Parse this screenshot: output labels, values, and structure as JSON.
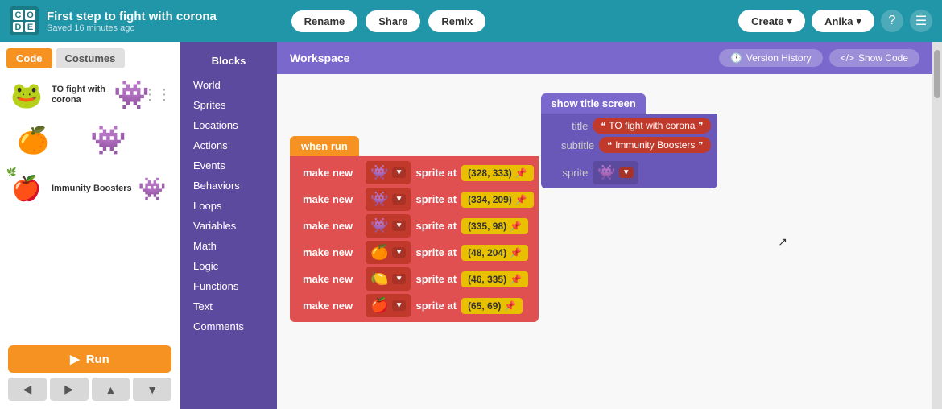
{
  "topbar": {
    "logo": [
      "C",
      "O",
      "D",
      "E"
    ],
    "project_title": "First step to fight with corona",
    "saved_status": "Saved 16 minutes ago",
    "rename_label": "Rename",
    "share_label": "Share",
    "remix_label": "Remix",
    "create_label": "Create",
    "user_label": "Anika",
    "help_icon": "?",
    "menu_icon": "☰"
  },
  "left_panel": {
    "tab_code": "Code",
    "tab_costumes": "Costumes",
    "sprites": [
      {
        "label": "TO fight with corona",
        "emoji": "🐸",
        "monster": "👾"
      },
      {
        "label": "",
        "emoji": "🍊",
        "monster": "👾"
      },
      {
        "label": "Immunity Boosters",
        "emoji": "🍎",
        "monster": "👾"
      }
    ],
    "run_label": "Run",
    "nav_buttons": [
      "◀",
      "▶",
      "▲",
      "▼"
    ]
  },
  "blocks_panel": {
    "header": "Blocks",
    "items": [
      "World",
      "Sprites",
      "Locations",
      "Actions",
      "Events",
      "Behaviors",
      "Loops",
      "Variables",
      "Math",
      "Logic",
      "Functions",
      "Text",
      "Comments"
    ]
  },
  "workspace": {
    "header": "Workspace",
    "version_history_label": "Version History",
    "show_code_label": "Show Code",
    "when_run_label": "when run",
    "blocks": [
      {
        "coords": "(328, 333)",
        "sprite": "👾"
      },
      {
        "coords": "(334, 209)",
        "sprite": "👾"
      },
      {
        "coords": "(335, 98)",
        "sprite": "👾"
      },
      {
        "coords": "(48, 204)",
        "sprite": "🍊"
      },
      {
        "coords": "(46, 335)",
        "sprite": "🍋"
      },
      {
        "coords": "(65, 69)",
        "sprite": "🍎"
      }
    ],
    "make_new_label": "make new",
    "sprite_at_label": "sprite at",
    "show_title_label": "show title screen",
    "title_field": "title",
    "title_value": "TO fight with corona",
    "subtitle_field": "subtitle",
    "subtitle_value": "Immunity Boosters",
    "sprite_field": "sprite"
  }
}
